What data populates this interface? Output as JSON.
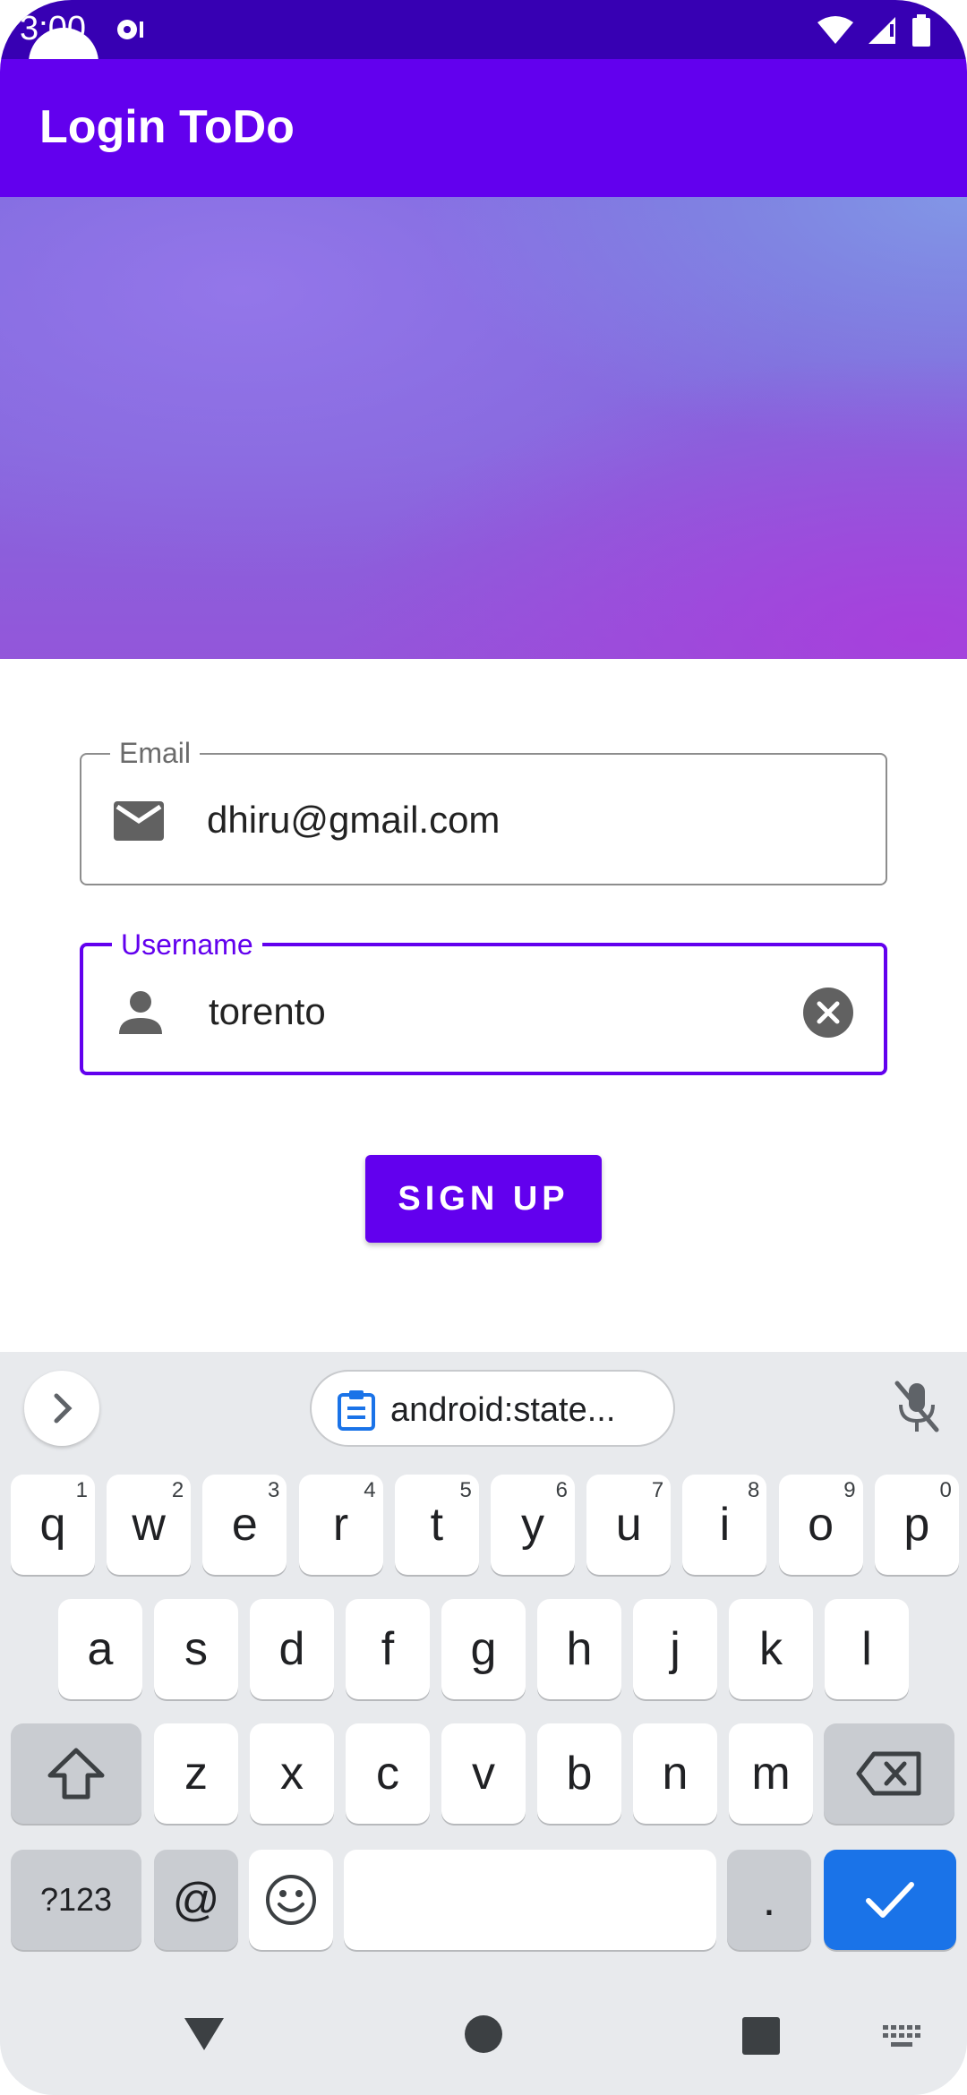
{
  "status_bar": {
    "time": "3:00"
  },
  "app_bar": {
    "title": "Login ToDo"
  },
  "form": {
    "email": {
      "label": "Email",
      "value": "dhiru@gmail.com"
    },
    "username": {
      "label": "Username",
      "value": "torento"
    },
    "signup_label": "SIGN UP"
  },
  "keyboard": {
    "suggestion": "android:state...",
    "row1": [
      {
        "label": "q",
        "hint": "1"
      },
      {
        "label": "w",
        "hint": "2"
      },
      {
        "label": "e",
        "hint": "3"
      },
      {
        "label": "r",
        "hint": "4"
      },
      {
        "label": "t",
        "hint": "5"
      },
      {
        "label": "y",
        "hint": "6"
      },
      {
        "label": "u",
        "hint": "7"
      },
      {
        "label": "i",
        "hint": "8"
      },
      {
        "label": "o",
        "hint": "9"
      },
      {
        "label": "p",
        "hint": "0"
      }
    ],
    "row2": [
      "a",
      "s",
      "d",
      "f",
      "g",
      "h",
      "j",
      "k",
      "l"
    ],
    "row3": [
      "z",
      "x",
      "c",
      "v",
      "b",
      "n",
      "m"
    ],
    "symbols_label": "?123",
    "at_label": "@",
    "period_label": "."
  },
  "colors": {
    "primary": "#6200ee",
    "primary_dark": "#3700b3",
    "keyboard_bg": "#e8eaed",
    "enter_key": "#1a73e8"
  },
  "icons": [
    "email-icon",
    "person-icon",
    "clear-icon",
    "chevron-right-icon",
    "clipboard-icon",
    "mic-off-icon",
    "shift-icon",
    "backspace-icon",
    "emoji-icon",
    "check-icon",
    "back-icon",
    "home-icon",
    "recents-icon",
    "keyboard-icon"
  ]
}
